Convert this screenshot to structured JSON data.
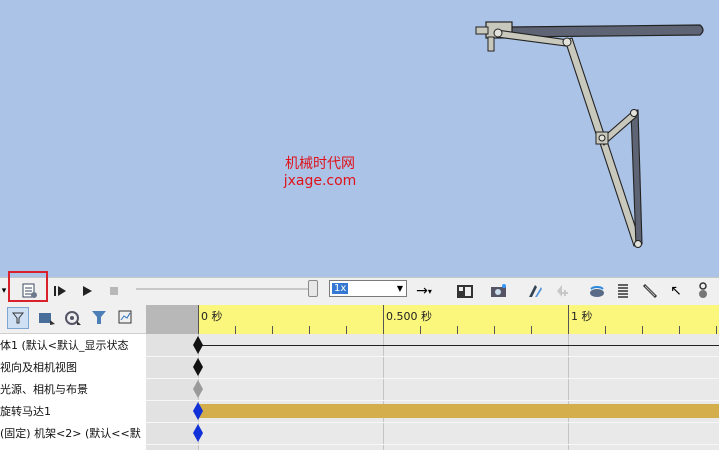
{
  "watermark": {
    "line1": "机械时代网",
    "line2": "jxage.com"
  },
  "toolbar": {
    "items": [
      {
        "name": "calculate-button-icon"
      },
      {
        "name": "play-from-start-icon"
      },
      {
        "name": "play-icon"
      },
      {
        "name": "stop-icon"
      }
    ],
    "playback_speed": "1x",
    "right_icons": [
      "playback-mode-arrow-icon",
      "save-animation-icon",
      "animation-wizard-icon",
      "autokey-icon",
      "add-update-key-icon",
      "motor-icon",
      "spring-icon",
      "damper-icon",
      "force-icon",
      "contact-icon"
    ]
  },
  "filters": [
    "filter-icon",
    "filter-animated-icon",
    "filter-driving-icon",
    "filter-selected-icon",
    "filter-results-icon"
  ],
  "timeline": {
    "ticks": [
      {
        "label": "0 秒",
        "t": 0
      },
      {
        "label": "0.500 秒",
        "t": 0.5
      },
      {
        "label": "1 秒",
        "t": 1
      }
    ]
  },
  "tree": {
    "rows": [
      {
        "label": "体1 (默认<默认_显示状态",
        "key_color": "#111111",
        "bar": "line"
      },
      {
        "label": "视向及相机视图",
        "key_color": "#111111",
        "bar": "none"
      },
      {
        "label": "光源、相机与布景",
        "key_color": "#9a9a9a",
        "bar": "none"
      },
      {
        "label": "旋转马达1",
        "key_color": "#1030d8",
        "bar": "gold"
      },
      {
        "label": "(固定) 机架<2> (默认<<默",
        "key_color": "#1030d8",
        "bar": "none"
      }
    ]
  },
  "colors": {
    "gold_bar": "#d4ae4a",
    "highlight": "#d8212a",
    "viewport_bg": "#aac3e6"
  }
}
